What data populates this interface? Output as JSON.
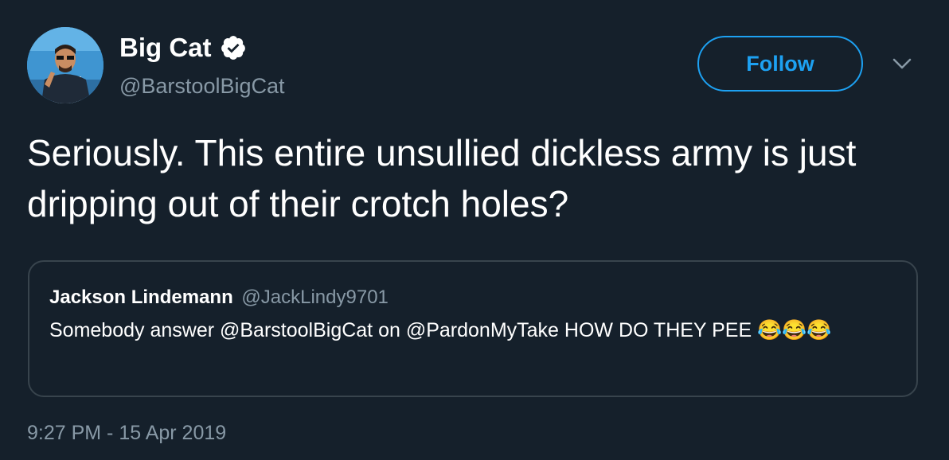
{
  "author": {
    "display_name": "Big Cat",
    "handle": "@BarstoolBigCat",
    "verified": true,
    "avatar_icon": "profile-photo"
  },
  "actions": {
    "follow_label": "Follow",
    "menu_icon": "chevron-down-icon"
  },
  "tweet": {
    "text": "Seriously. This entire unsullied dickless army is just dripping out of their crotch holes?"
  },
  "quoted_tweet": {
    "display_name": "Jackson Lindemann",
    "handle": "@JackLindy9701",
    "text": "Somebody answer @BarstoolBigCat on @PardonMyTake HOW DO THEY PEE 😂😂😂"
  },
  "timestamp": "9:27 PM - 15 Apr 2019",
  "colors": {
    "background": "#15202b",
    "accent": "#1da1f2",
    "secondary_text": "#8899a6",
    "border": "#38444d"
  }
}
